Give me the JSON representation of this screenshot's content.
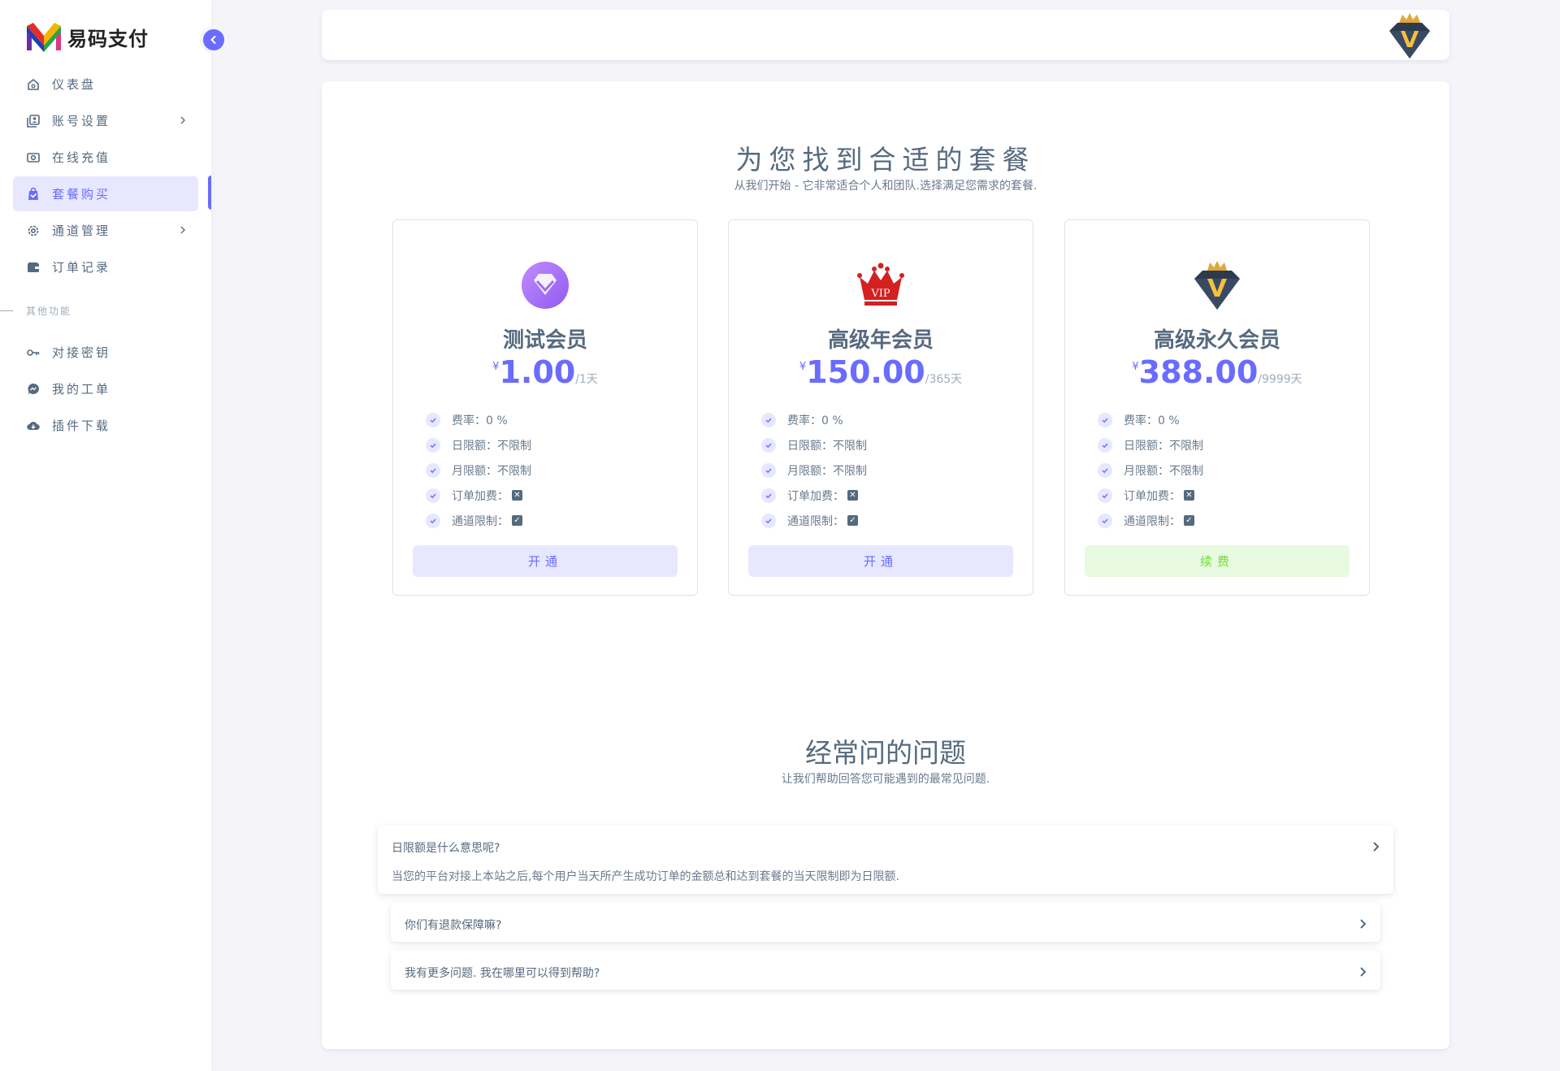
{
  "brand": {
    "name": "易码支付"
  },
  "sidebar": {
    "items": [
      {
        "label": "仪表盘",
        "icon": "home-icon"
      },
      {
        "label": "账号设置",
        "icon": "account-icon",
        "has_submenu": true
      },
      {
        "label": "在线充值",
        "icon": "recharge-icon"
      },
      {
        "label": "套餐购买",
        "icon": "package-icon",
        "active": true
      },
      {
        "label": "通道管理",
        "icon": "gear-icon",
        "has_submenu": true
      },
      {
        "label": "订单记录",
        "icon": "wallet-icon"
      }
    ],
    "section_header": "其他功能",
    "other_items": [
      {
        "label": "对接密钥",
        "icon": "key-icon"
      },
      {
        "label": "我的工单",
        "icon": "message-icon"
      },
      {
        "label": "插件下载",
        "icon": "cloud-download-icon"
      }
    ]
  },
  "pricing": {
    "title": "为您找到合适的套餐",
    "subtitle": "从我们开始 - 它非常适合个人和团队.选择满足您需求的套餐.",
    "plans": [
      {
        "name": "测试会员",
        "currency": "¥",
        "price": "1.00",
        "period": "/1天",
        "icon": "diamond-badge-icon",
        "features": [
          "费率：0 %",
          "日限额：不限制",
          "月限额：不限制",
          "订单加费：",
          "通道限制："
        ],
        "button": "开通"
      },
      {
        "name": "高级年会员",
        "currency": "¥",
        "price": "150.00",
        "period": "/365天",
        "icon": "vip-crown-icon",
        "features": [
          "费率：0 %",
          "日限额：不限制",
          "月限额：不限制",
          "订单加费：",
          "通道限制："
        ],
        "button": "开通"
      },
      {
        "name": "高级永久会员",
        "currency": "¥",
        "price": "388.00",
        "period": "/9999天",
        "icon": "crown-v-diamond-icon",
        "features": [
          "费率：0 %",
          "日限额：不限制",
          "月限额：不限制",
          "订单加费：",
          "通道限制："
        ],
        "button": "续费"
      }
    ]
  },
  "faq": {
    "title": "经常问的问题",
    "subtitle": "让我们帮助回答您可能遇到的最常见问题.",
    "items": [
      {
        "q": "日限额是什么意思呢?",
        "a": "当您的平台对接上本站之后,每个用户当天所产生成功订单的金额总和达到套餐的当天限制即为日限额.",
        "expanded": true
      },
      {
        "q": "你们有退款保障嘛?"
      },
      {
        "q": "我有更多问题. 我在哪里可以得到帮助?"
      }
    ]
  },
  "colors": {
    "primary": "#696cff",
    "success": "#71dd37",
    "text": "#566a7f"
  }
}
